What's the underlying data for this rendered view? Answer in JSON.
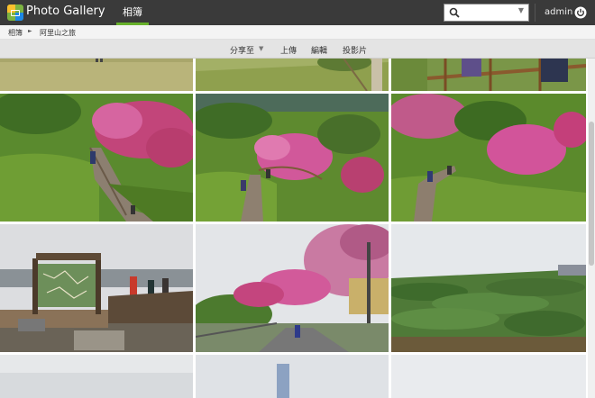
{
  "app": {
    "title": "Photo Gallery"
  },
  "nav": {
    "active_tab": "相簿"
  },
  "search": {
    "icon": "search-icon"
  },
  "user": {
    "name": "admin",
    "logout_icon": "power-icon"
  },
  "breadcrumb": {
    "home": "相簿",
    "separator": "►",
    "current": "阿里山之旅"
  },
  "toolbar": {
    "share": "分享至",
    "share_caret": "▼",
    "upload": "上傳",
    "edit": "編輯",
    "slideshow": "投影片"
  },
  "photos": [
    {
      "name": "partial-top-1"
    },
    {
      "name": "partial-top-2"
    },
    {
      "name": "partial-top-3"
    },
    {
      "name": "cherry-blossom-walkway-1"
    },
    {
      "name": "cherry-blossom-walkway-2"
    },
    {
      "name": "cherry-blossom-walkway-3"
    },
    {
      "name": "trail-map-sign"
    },
    {
      "name": "cherry-blossom-road"
    },
    {
      "name": "tea-plantation"
    },
    {
      "name": "partial-bottom-1"
    },
    {
      "name": "partial-bottom-2"
    },
    {
      "name": "partial-bottom-3"
    }
  ],
  "colors": {
    "topbar": "#3a3a3a",
    "accent": "#67b12b",
    "toolbar": "#e4e4e4"
  }
}
